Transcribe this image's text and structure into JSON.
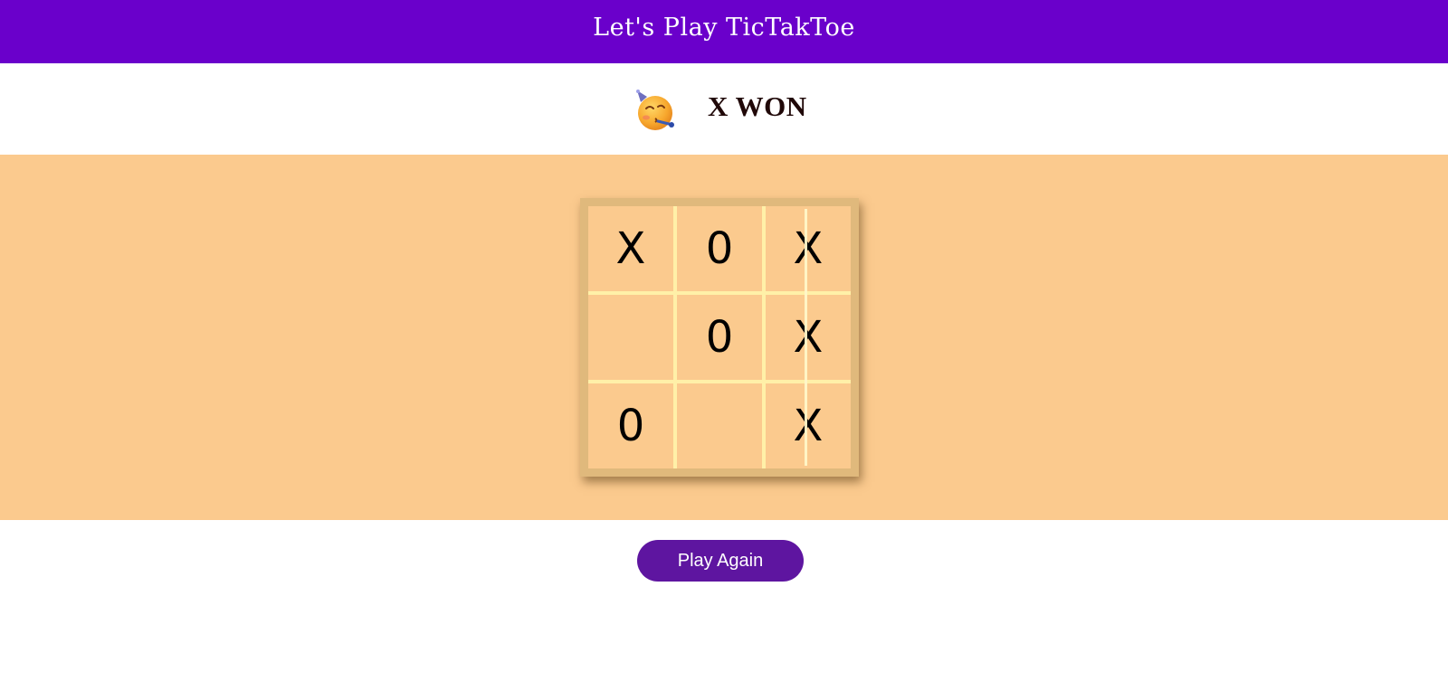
{
  "header": {
    "title": "Let's Play TicTakToe"
  },
  "status": {
    "emoji_icon": "partying-face-icon",
    "text": "X WON"
  },
  "board": {
    "cells": [
      [
        "X",
        "0",
        "X"
      ],
      [
        "",
        "0",
        "X"
      ],
      [
        "0",
        "",
        "X"
      ]
    ],
    "winning_line": "column-3"
  },
  "actions": {
    "play_again_label": "Play Again"
  },
  "colors": {
    "header_bg": "#6a00cb",
    "board_area_bg": "#fbca8e",
    "button_bg": "#5e15a0"
  }
}
